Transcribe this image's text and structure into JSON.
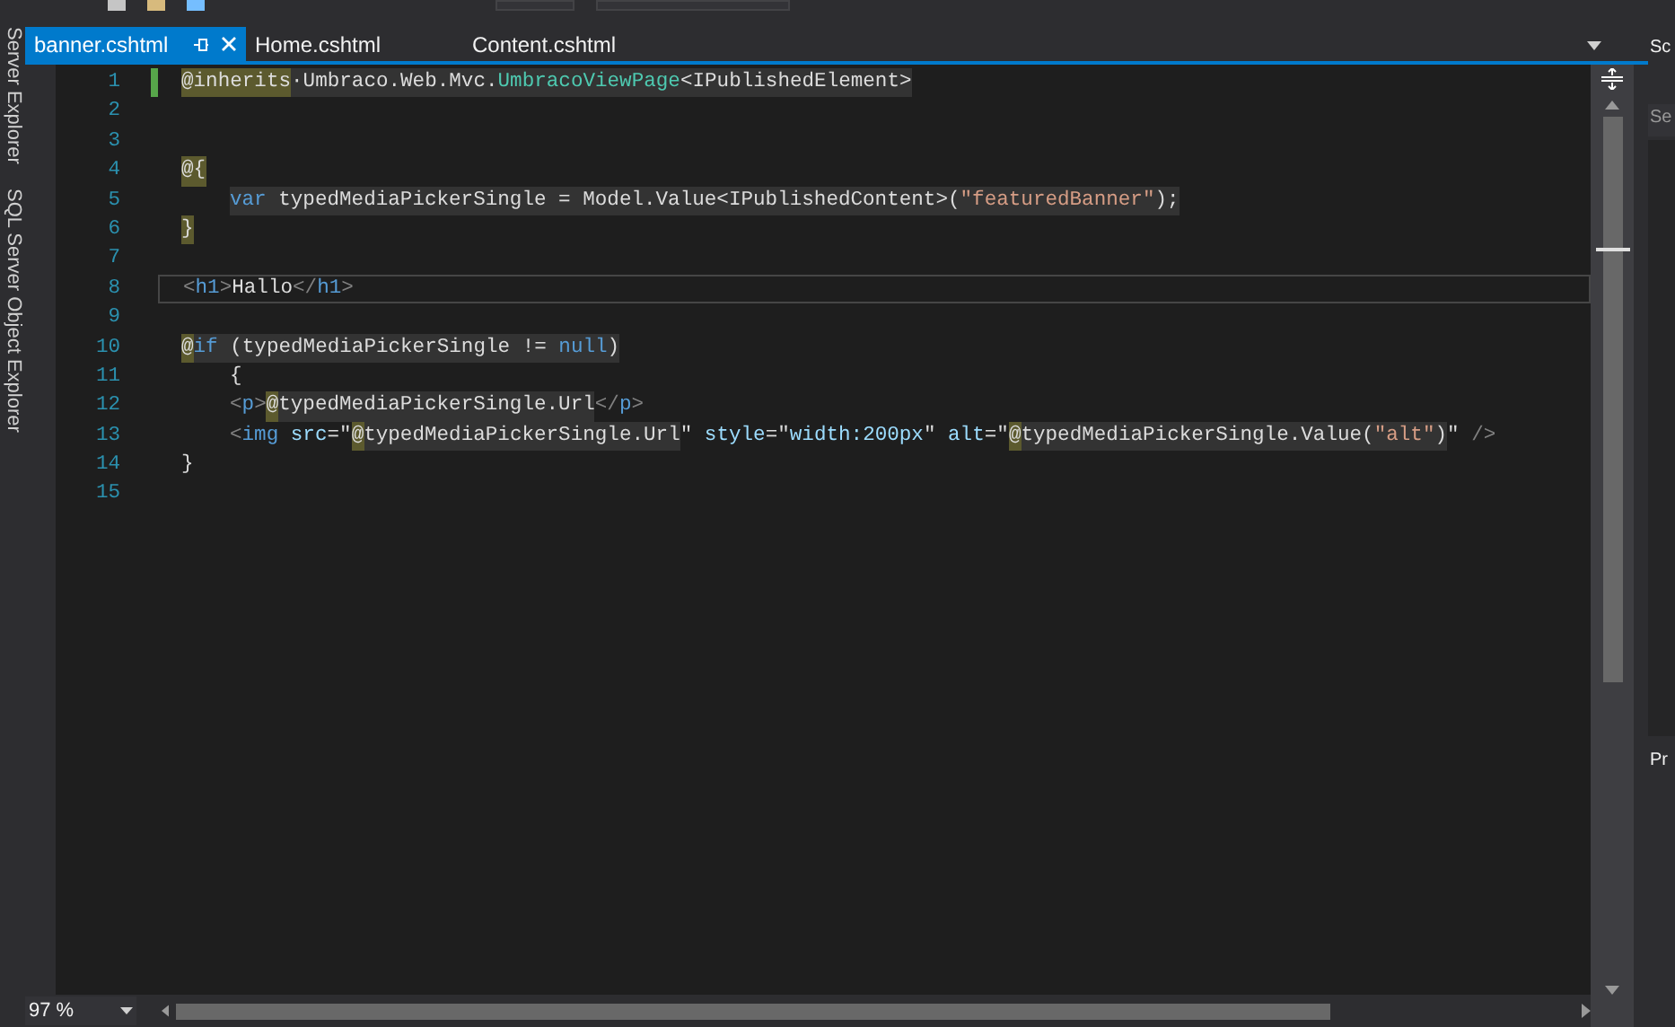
{
  "side_panel": {
    "items": [
      "Server Explorer",
      "SQL Server Object Explorer"
    ]
  },
  "tabs": [
    {
      "label": "banner.cshtml",
      "selected": true,
      "pinned": true
    },
    {
      "label": "Home.cshtml",
      "selected": false,
      "pinned": false
    },
    {
      "label": "Content.cshtml",
      "selected": false,
      "pinned": false
    }
  ],
  "editor": {
    "lines": [
      {
        "number": "1",
        "changed": true,
        "indented": false,
        "current": false,
        "tokens": [
          {
            "kind": "razor",
            "text": "@inherits"
          },
          {
            "kind": "plain",
            "text": "·Umbraco.Web.Mvc.",
            "shaded": true
          },
          {
            "kind": "type",
            "text": "UmbracoViewPage",
            "shaded": true
          },
          {
            "kind": "plain",
            "text": "<IPublishedElement>",
            "shaded": true
          }
        ]
      },
      {
        "number": "2",
        "current": false
      },
      {
        "number": "3",
        "current": false
      },
      {
        "number": "4",
        "indented": false,
        "current": false,
        "tokens": [
          {
            "kind": "razor",
            "text": "@{"
          }
        ]
      },
      {
        "number": "5",
        "indented": true,
        "current": false,
        "tokens": [
          {
            "kind": "keyword",
            "text": "var",
            "shaded": true
          },
          {
            "kind": "plain",
            "text": " typedMediaPickerSingle = Model.Value<IPublishedContent>(",
            "shaded": true
          },
          {
            "kind": "string",
            "text": "\"featuredBanner\"",
            "shaded": true
          },
          {
            "kind": "plain",
            "text": ");",
            "shaded": true
          }
        ]
      },
      {
        "number": "6",
        "indented": false,
        "current": false,
        "tokens": [
          {
            "kind": "razor",
            "text": "}"
          }
        ]
      },
      {
        "number": "7",
        "current": false
      },
      {
        "number": "8",
        "indented": false,
        "current": true,
        "tokens": [
          {
            "kind": "punct",
            "text": "<",
            "shaded": false
          },
          {
            "kind": "tag",
            "text": "h1",
            "shaded": false
          },
          {
            "kind": "punct",
            "text": ">",
            "shaded": false
          },
          {
            "kind": "plain",
            "text": "Hallo",
            "shaded": false
          },
          {
            "kind": "punct",
            "text": "</",
            "shaded": false
          },
          {
            "kind": "tag",
            "text": "h1",
            "shaded": false
          },
          {
            "kind": "punct",
            "text": ">",
            "shaded": false
          }
        ]
      },
      {
        "number": "9",
        "current": false
      },
      {
        "number": "10",
        "indented": false,
        "current": false,
        "tokens": [
          {
            "kind": "razor",
            "text": "@"
          },
          {
            "kind": "keyword",
            "text": "if",
            "shaded": true
          },
          {
            "kind": "plain",
            "text": " (typedMediaPickerSingle != ",
            "shaded": true
          },
          {
            "kind": "keyword",
            "text": "null",
            "shaded": true
          },
          {
            "kind": "plain",
            "text": ")",
            "shaded": true
          }
        ]
      },
      {
        "number": "11",
        "indented": true,
        "current": false,
        "tokens": [
          {
            "kind": "plain",
            "text": "{",
            "shaded": false
          }
        ]
      },
      {
        "number": "12",
        "indented": true,
        "current": false,
        "tokens": [
          {
            "kind": "punct",
            "text": "<",
            "shaded": false
          },
          {
            "kind": "tag",
            "text": "p",
            "shaded": false
          },
          {
            "kind": "punct",
            "text": ">",
            "shaded": false
          },
          {
            "kind": "razor",
            "text": "@"
          },
          {
            "kind": "plain",
            "text": "typedMediaPickerSingle.Url",
            "shaded": true
          },
          {
            "kind": "punct",
            "text": "</",
            "shaded": false
          },
          {
            "kind": "tag",
            "text": "p",
            "shaded": false
          },
          {
            "kind": "punct",
            "text": ">",
            "shaded": false
          }
        ]
      },
      {
        "number": "13",
        "indented": true,
        "current": false,
        "tokens": [
          {
            "kind": "punct",
            "text": "<",
            "shaded": false
          },
          {
            "kind": "tag",
            "text": "img",
            "shaded": false
          },
          {
            "kind": "attr",
            "text": " src",
            "shaded": false
          },
          {
            "kind": "plain",
            "text": "=\"",
            "shaded": false
          },
          {
            "kind": "razor",
            "text": "@"
          },
          {
            "kind": "plain",
            "text": "typedMediaPickerSingle.Url",
            "shaded": true
          },
          {
            "kind": "plain",
            "text": "\"",
            "shaded": false
          },
          {
            "kind": "attr",
            "text": " style",
            "shaded": false
          },
          {
            "kind": "plain",
            "text": "=\"",
            "shaded": false
          },
          {
            "kind": "attr",
            "text": "width:200px",
            "shaded": false
          },
          {
            "kind": "plain",
            "text": "\"",
            "shaded": false
          },
          {
            "kind": "attr",
            "text": " alt",
            "shaded": false
          },
          {
            "kind": "plain",
            "text": "=\"",
            "shaded": false
          },
          {
            "kind": "razor",
            "text": "@"
          },
          {
            "kind": "plain",
            "text": "typedMediaPickerSingle.Value(",
            "shaded": true
          },
          {
            "kind": "string",
            "text": "\"alt\"",
            "shaded": true
          },
          {
            "kind": "plain",
            "text": ")",
            "shaded": true
          },
          {
            "kind": "plain",
            "text": "\"",
            "shaded": false
          },
          {
            "kind": "punct",
            "text": " />",
            "shaded": false
          }
        ]
      },
      {
        "number": "14",
        "indented": false,
        "current": false,
        "tokens": [
          {
            "kind": "plain",
            "text": "}",
            "shaded": false
          }
        ]
      },
      {
        "number": "15",
        "current": false
      }
    ]
  },
  "zoom": "97 %",
  "right_panel": {
    "labels": [
      "Sc",
      "Se",
      "Pr"
    ]
  }
}
